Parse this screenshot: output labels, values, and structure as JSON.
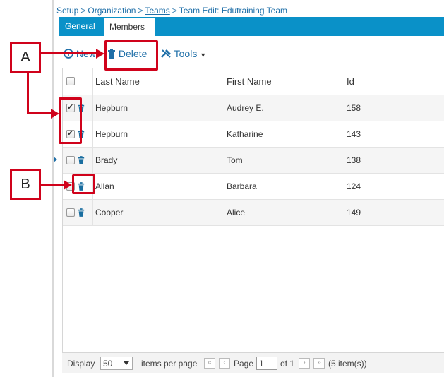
{
  "breadcrumb": {
    "setup": "Setup",
    "organization": "Organization",
    "teams": "Teams",
    "current": "Team Edit: Edutraining Team",
    "separator": ">"
  },
  "tabs": [
    {
      "label": "General",
      "active": false
    },
    {
      "label": "Members",
      "active": true
    }
  ],
  "toolbar": {
    "new_label": "New",
    "delete_label": "Delete",
    "tools_label": "Tools"
  },
  "grid": {
    "columns": [
      "Last Name",
      "First Name",
      "Id"
    ],
    "rows": [
      {
        "last": "Hepburn",
        "first": "Audrey E.",
        "id": "158",
        "checked": true
      },
      {
        "last": "Hepburn",
        "first": "Katharine",
        "id": "143",
        "checked": true
      },
      {
        "last": "Brady",
        "first": "Tom",
        "id": "138",
        "checked": false
      },
      {
        "last": "Allan",
        "first": "Barbara",
        "id": "124",
        "checked": false
      },
      {
        "last": "Cooper",
        "first": "Alice",
        "id": "149",
        "checked": false
      }
    ]
  },
  "pager": {
    "display_label": "Display",
    "page_size": "50",
    "items_per_page": "items per page",
    "page_label": "Page",
    "page_value": "1",
    "of_label": "of 1",
    "count_label": "(5 item(s))"
  },
  "callouts": {
    "a": "A",
    "b": "B"
  },
  "colors": {
    "accent": "#0a91c8",
    "link": "#1f6fa8",
    "callout": "#d0021b"
  }
}
